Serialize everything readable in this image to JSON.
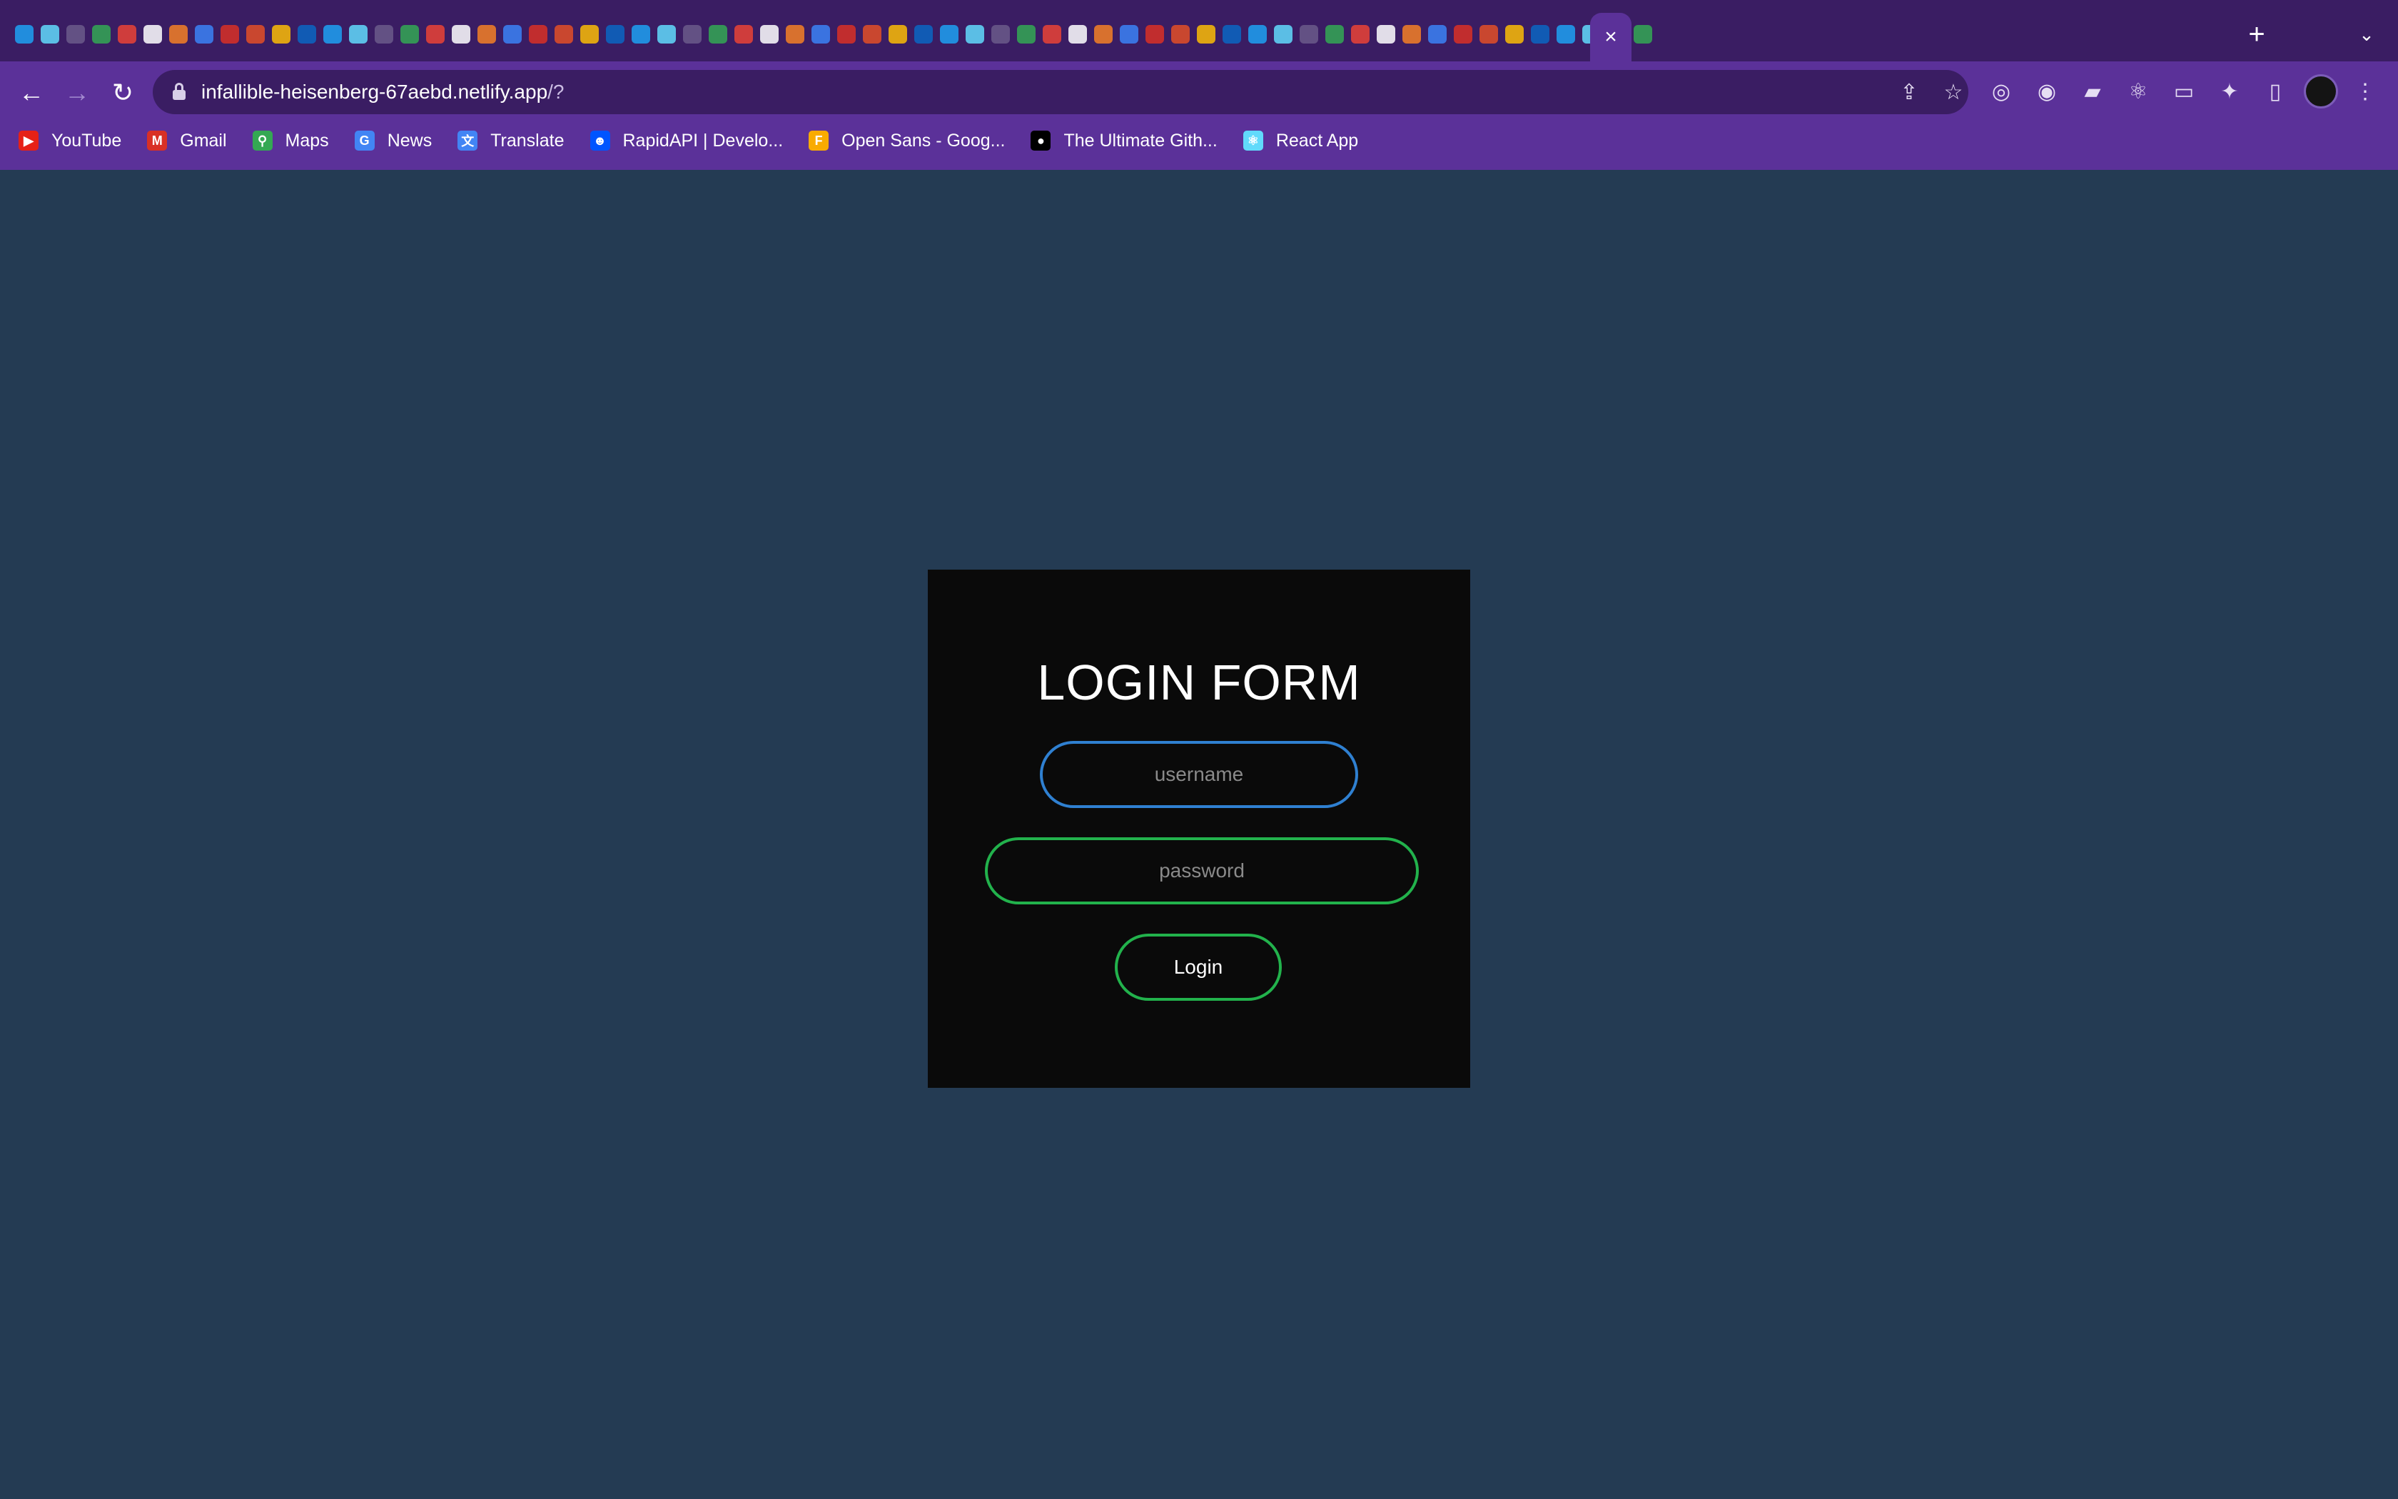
{
  "browser": {
    "tabs": {
      "active_close_glyph": "×",
      "new_tab_glyph": "+",
      "tab_search_glyph": "⌄"
    },
    "toolbar": {
      "back_glyph": "←",
      "forward_glyph": "→",
      "reload_glyph": "↻",
      "url_host": "infallible-heisenberg-67aebd.netlify.app",
      "url_rest": "/?",
      "share_glyph": "⇪",
      "bookmark_star_glyph": "☆"
    },
    "extensions": [
      {
        "name": "target-icon",
        "glyph": "◎"
      },
      {
        "name": "swirl-icon",
        "glyph": "◉"
      },
      {
        "name": "sheets-ext-icon",
        "glyph": "▰"
      },
      {
        "name": "react-devtools-icon",
        "glyph": "⚛"
      },
      {
        "name": "window-ext-icon",
        "glyph": "▭"
      },
      {
        "name": "puzzle-icon",
        "glyph": "✦"
      },
      {
        "name": "side-panel-icon",
        "glyph": "▯"
      }
    ],
    "menu_glyph": "⋮",
    "bookmarks": [
      {
        "label": "YouTube",
        "icon": "youtube-icon",
        "color": "#e62117",
        "glyph": "▶"
      },
      {
        "label": "Gmail",
        "icon": "gmail-icon",
        "color": "#d93025",
        "glyph": "M"
      },
      {
        "label": "Maps",
        "icon": "maps-icon",
        "color": "#34a853",
        "glyph": "⚲"
      },
      {
        "label": "News",
        "icon": "news-icon",
        "color": "#4285f4",
        "glyph": "G"
      },
      {
        "label": "Translate",
        "icon": "translate-icon",
        "color": "#4285f4",
        "glyph": "文"
      },
      {
        "label": "RapidAPI | Develo...",
        "icon": "rapidapi-icon",
        "color": "#0055ff",
        "glyph": "☻"
      },
      {
        "label": "Open Sans - Goog...",
        "icon": "google-fonts-icon",
        "color": "#f9ab00",
        "glyph": "F"
      },
      {
        "label": "The Ultimate Gith...",
        "icon": "medium-icon",
        "color": "#000000",
        "glyph": "●"
      },
      {
        "label": "React App",
        "icon": "react-icon",
        "color": "#61dafb",
        "glyph": "⚛"
      }
    ]
  },
  "login": {
    "title": "LOGIN FORM",
    "username_placeholder": "username",
    "password_placeholder": "password",
    "button_label": "Login"
  },
  "colors": {
    "page_background": "#243b53",
    "card_background": "#0a0a0a",
    "username_border": "#2f80d1",
    "password_border": "#22b24c",
    "button_border": "#22b24c",
    "browser_frame": "#5b3199"
  }
}
